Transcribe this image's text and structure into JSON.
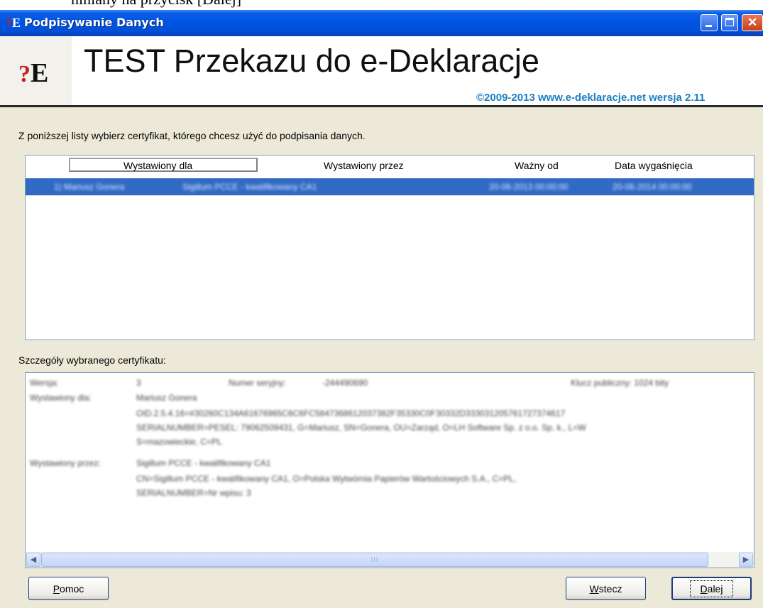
{
  "doc_fragment": "niniany na przycisk [Dalej]",
  "window": {
    "title": "Podpisywanie Danych",
    "icon": "e-deklaracje-logo-icon"
  },
  "banner": {
    "logo_q": "?",
    "logo_e": "E",
    "title": "TEST Przekazu do e-Deklaracje",
    "copyright": "©2009-2013 www.e-deklaracje.net wersja 2.11"
  },
  "instruction": "Z poniższej listy wybierz certyfikat, którego chcesz użyć do podpisania danych.",
  "cert_list": {
    "columns": [
      "Wystawiony dla",
      "Wystawiony przez",
      "Ważny od",
      "Data wygaśnięcia"
    ],
    "rows": [
      {
        "issued_for": "1) Mariusz Gonera",
        "issued_by": "Sigillum PCCE - kwalifikowany CA1",
        "valid_from": "20-06-2013 00:00:00",
        "expires": "20-06-2014 00:00:00",
        "selected": true
      }
    ]
  },
  "details": {
    "label": "Szczegóły wybranego certyfikatu:",
    "version_label": "Wersja:",
    "version": "3",
    "serial_label": "Numer seryjny:",
    "serial": "-244490690",
    "pubkey": "Klucz publiczny: 1024 bity",
    "subject_label": "Wystawiony dla:",
    "subject_name": "Mariusz Gonera",
    "subject_line1": "OID.2.5.4.16=#30260C134A61676965C6C6FC5847368612037382F35330C0F30332D333031205761727374617",
    "subject_line2": "SERIALNUMBER=PESEL: 79062509431, G=Mariusz, SN=Gonera, OU=Zarząd, O=LH Software Sp. z o.o. Sp. k., L=W",
    "subject_line3": "S=mazowieckie, C=PL",
    "issuer_label": "Wystawiony przez:",
    "issuer_name": "Sigillum PCCE - kwalifikowany CA1",
    "issuer_line1": "CN=Sigillum PCCE - kwalifikowany CA1, O=Polska Wytwórnia Papierów Wartościowych S.A., C=PL,",
    "issuer_line2": "SERIALNUMBER=Nr wpisu: 3",
    "scroll_grip": "III"
  },
  "buttons": {
    "help_key": "P",
    "help_rest": "omoc",
    "back_key": "W",
    "back_rest": "stecz",
    "next_key": "D",
    "next_rest": "alej"
  },
  "colors": {
    "titlebar": "#0054e3",
    "selection": "#316ac5",
    "dialog_bg": "#ece9d8",
    "copyright": "#1d7fc2"
  }
}
